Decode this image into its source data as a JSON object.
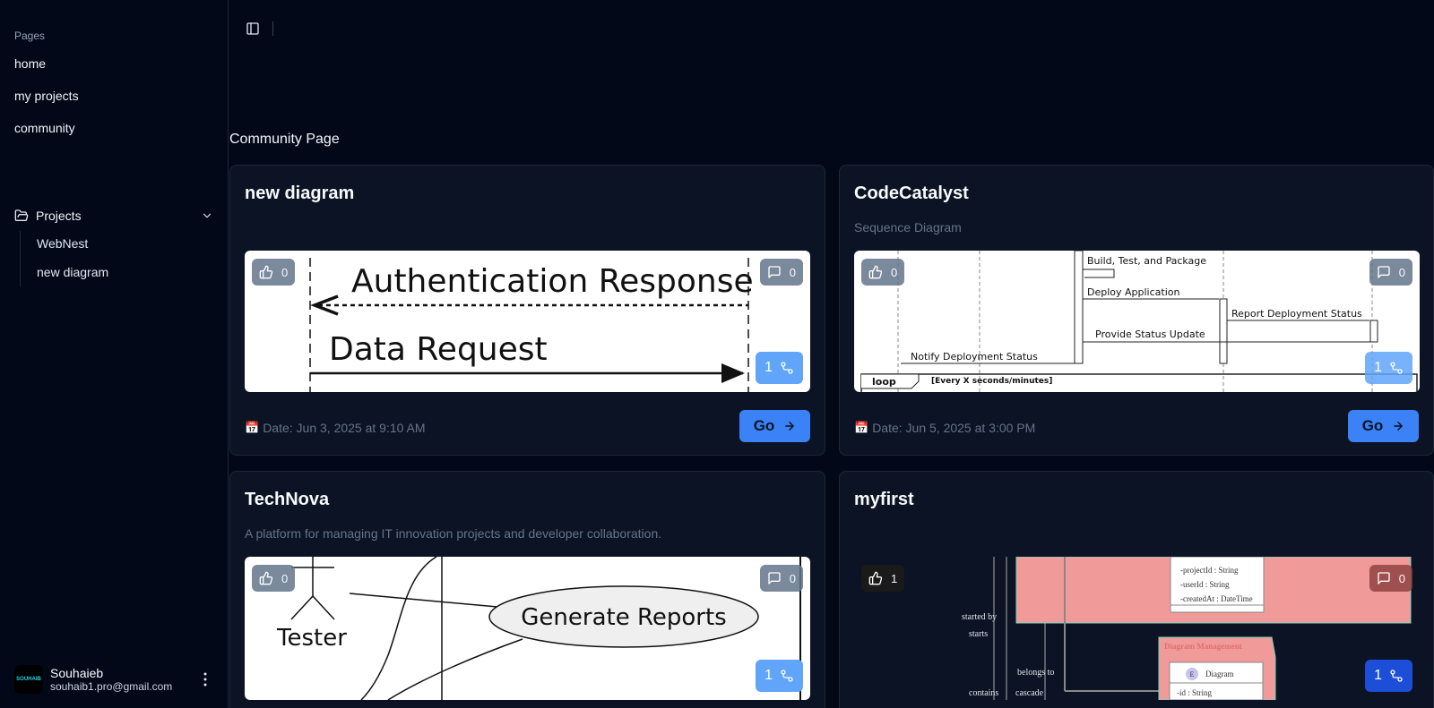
{
  "sidebar": {
    "section_label": "Pages",
    "links": [
      "home",
      "my projects",
      "community"
    ],
    "projects_label": "Projects",
    "projects": [
      "WebNest",
      "new diagram"
    ],
    "user": {
      "name": "Souhaieb",
      "email": "souhaib1.pro@gmail.com",
      "avatar_text": "SOUHAIB"
    }
  },
  "page_title": "Community Page",
  "cards": [
    {
      "title": "new diagram",
      "description": "",
      "likes": "0",
      "comments": "0",
      "forks": "1",
      "date": "Date: Jun 3, 2025 at 9:10 AM",
      "go": "Go",
      "preview_text": [
        "Authentication Response",
        "Data Request"
      ]
    },
    {
      "title": "CodeCatalyst",
      "description": "Sequence Diagram",
      "likes": "0",
      "comments": "0",
      "forks": "1",
      "date": "Date: Jun 5, 2025 at 3:00 PM",
      "go": "Go",
      "preview_text": [
        "Build, Test, and Package",
        "Deploy Application",
        "Report Deployment Status",
        "Provide Status Update",
        "Notify Deployment Status",
        "loop",
        "[Every X seconds/minutes]"
      ]
    },
    {
      "title": "TechNova",
      "description": "A platform for managing IT innovation projects and developer collaboration.",
      "likes": "0",
      "comments": "0",
      "forks": "1",
      "preview_text": [
        "Tester",
        "Generate Reports"
      ]
    },
    {
      "title": "myfirst",
      "description": "",
      "likes": "1",
      "comments": "0",
      "forks": "1",
      "preview_text": [
        "-projectId : String",
        "-userId : String",
        "-createdAt : DateTime",
        "started by",
        "starts",
        "Diagram Management",
        "belongs to",
        "Diagram",
        "-id : String",
        "contains",
        "cascade"
      ]
    }
  ],
  "colors": {
    "background": "#020817",
    "card": "#0b1324",
    "accent": "#3b82f6",
    "fork": "#60a5fa",
    "pink": "#f19a9a"
  },
  "icons": [
    "thumbs-up-icon",
    "message-square-icon",
    "git-fork-icon",
    "arrow-right-icon",
    "calendar-icon",
    "folder-icon",
    "chevron-down-icon",
    "sidebar-toggle-icon",
    "more-vertical-icon"
  ]
}
